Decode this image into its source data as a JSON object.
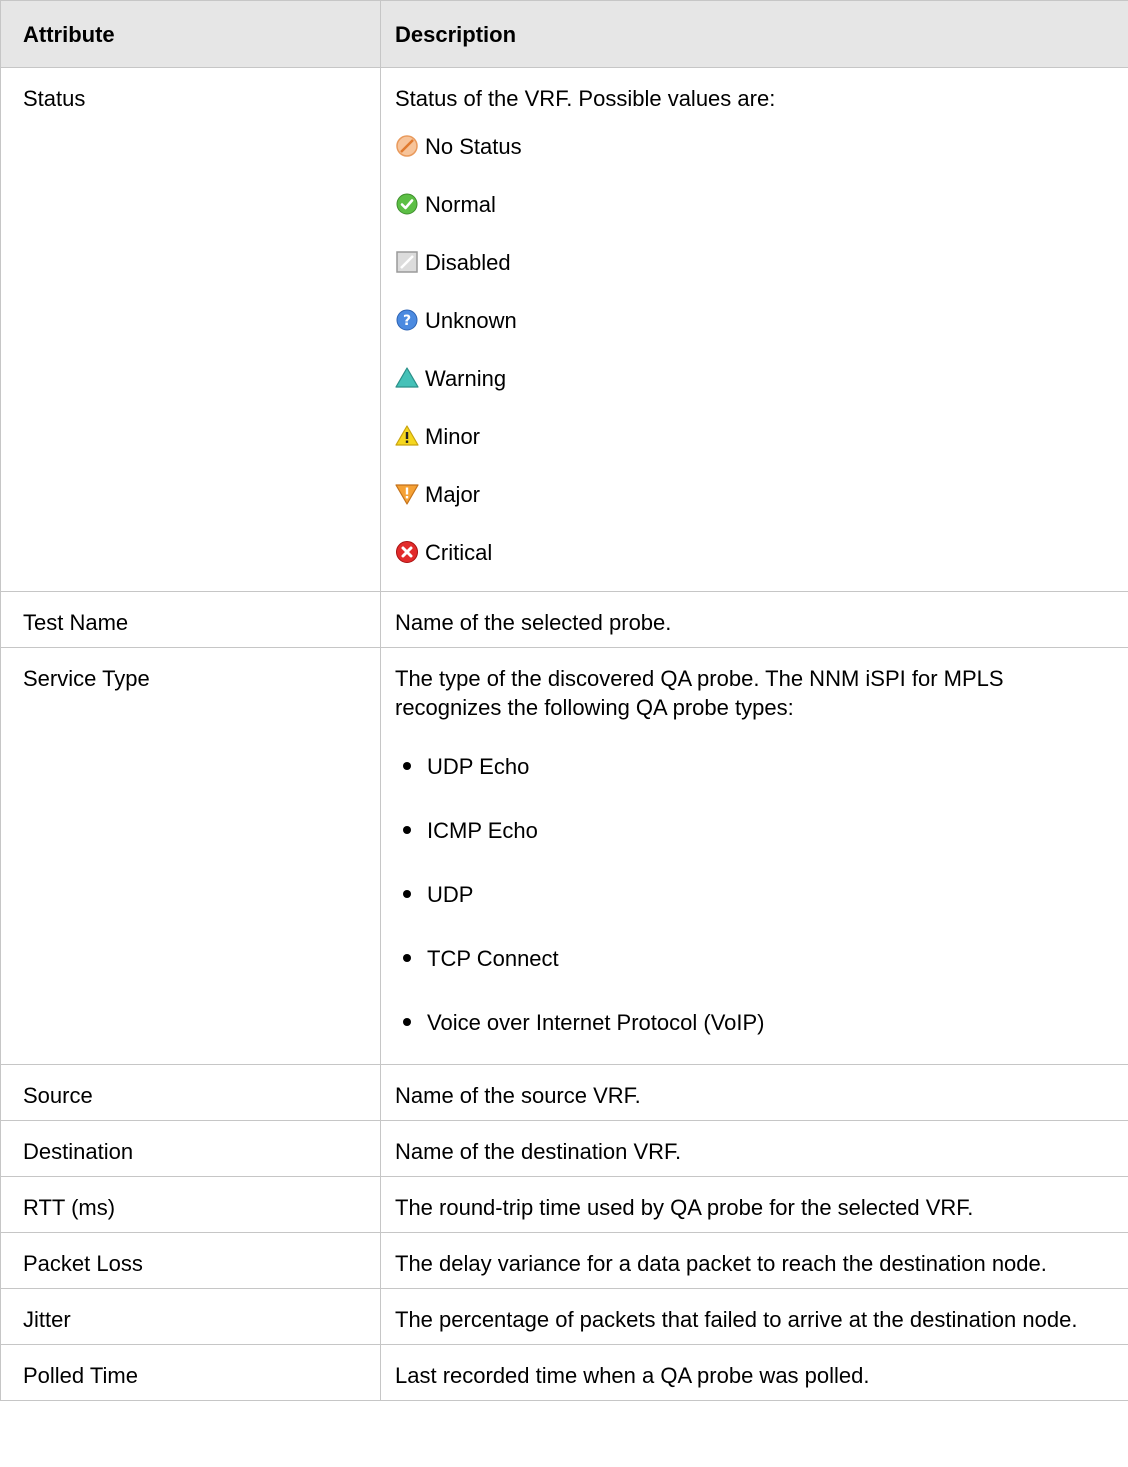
{
  "headers": {
    "attribute": "Attribute",
    "description": "Description"
  },
  "status_row": {
    "name": "Status",
    "intro": "Status of the VRF. Possible values are:",
    "values": [
      {
        "label": "No Status",
        "icon": "no-status-icon",
        "color": "#f2a66b"
      },
      {
        "label": "Normal",
        "icon": "normal-icon",
        "color": "#4cae3c"
      },
      {
        "label": "Disabled",
        "icon": "disabled-icon",
        "color": "#b8b8b8"
      },
      {
        "label": "Unknown",
        "icon": "unknown-icon",
        "color": "#3f7ed6"
      },
      {
        "label": "Warning",
        "icon": "warning-icon",
        "color": "#3fb8b0"
      },
      {
        "label": "Minor",
        "icon": "minor-icon",
        "color": "#f2d21b"
      },
      {
        "label": "Major",
        "icon": "major-icon",
        "color": "#f28c1b"
      },
      {
        "label": "Critical",
        "icon": "critical-icon",
        "color": "#e02020"
      }
    ]
  },
  "test_name_row": {
    "name": "Test Name",
    "description": "Name of the selected probe."
  },
  "service_type_row": {
    "name": "Service Type",
    "intro": "The type of the discovered QA probe. The NNM iSPI for MPLS recognizes the following QA probe types:",
    "types": [
      "UDP Echo",
      "ICMP Echo",
      "UDP",
      "TCP Connect",
      "Voice over Internet Protocol (VoIP)"
    ]
  },
  "rows": [
    {
      "name": "Source",
      "description": "Name of the source VRF."
    },
    {
      "name": "Destination",
      "description": "Name of the destination VRF."
    },
    {
      "name": "RTT (ms)",
      "description": "The round-trip time used by QA probe for the selected VRF."
    },
    {
      "name": "Packet Loss",
      "description": "The delay variance for a data packet to reach the destination node."
    },
    {
      "name": "Jitter",
      "description": "The percentage of packets that failed to arrive at the destination node."
    },
    {
      "name": "Polled Time",
      "description": "Last recorded time when a QA probe was polled."
    }
  ]
}
